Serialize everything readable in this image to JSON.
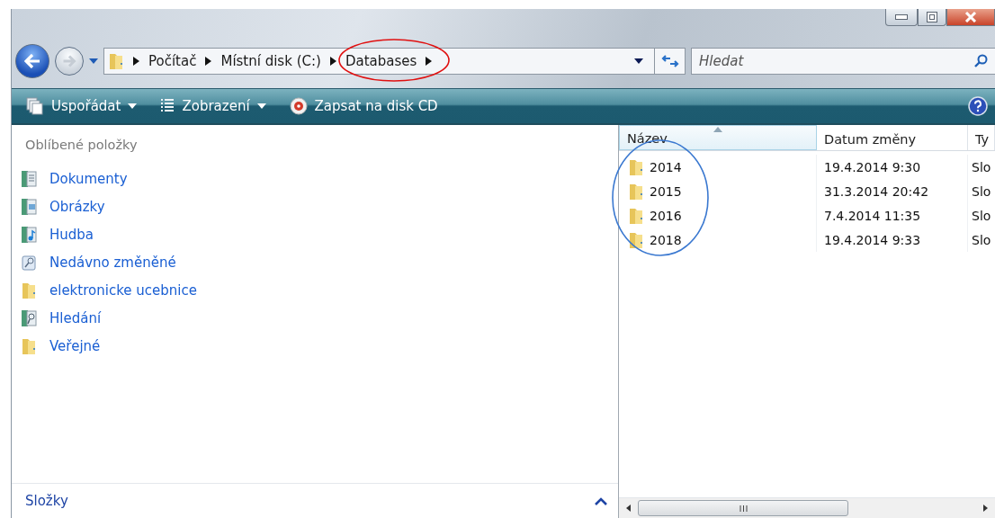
{
  "breadcrumb": [
    {
      "label": "Počítač"
    },
    {
      "label": "Místní disk (C:)"
    },
    {
      "label": "Databases"
    }
  ],
  "search": {
    "placeholder": "Hledat"
  },
  "toolbar": [
    {
      "label": "Uspořádat",
      "kind": "organize"
    },
    {
      "label": "Zobrazení",
      "kind": "views"
    },
    {
      "label": "Zapsat na disk CD",
      "kind": "burn"
    }
  ],
  "sidebar": {
    "title": "Oblíbené položky",
    "items": [
      {
        "label": "Dokumenty",
        "kind": "documents"
      },
      {
        "label": "Obrázky",
        "kind": "pictures"
      },
      {
        "label": "Hudba",
        "kind": "music"
      },
      {
        "label": "Nedávno změněné",
        "kind": "recent"
      },
      {
        "label": "elektronicke ucebnice",
        "kind": "folder"
      },
      {
        "label": "Hledání",
        "kind": "search"
      },
      {
        "label": "Veřejné",
        "kind": "folder"
      }
    ],
    "footer": "Složky"
  },
  "table": {
    "columns": [
      {
        "label": "Název",
        "sorted": true
      },
      {
        "label": "Datum změny",
        "sorted": false
      },
      {
        "label": "Ty",
        "sorted": false
      }
    ],
    "rows": [
      {
        "name": "2014",
        "date": "19.4.2014 9:30",
        "type": "Slo"
      },
      {
        "name": "2015",
        "date": "31.3.2014 20:42",
        "type": "Slo"
      },
      {
        "name": "2016",
        "date": "7.4.2014 11:35",
        "type": "Slo"
      },
      {
        "name": "2018",
        "date": "19.4.2014 9:33",
        "type": "Slo"
      }
    ]
  }
}
